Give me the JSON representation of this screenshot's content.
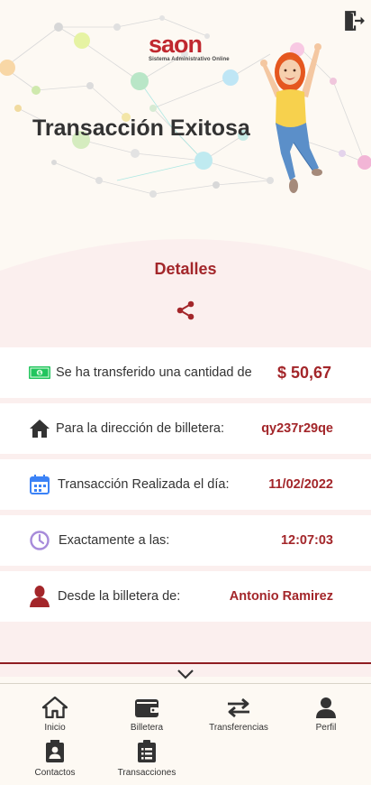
{
  "header": {
    "brand_name": "saon",
    "brand_tagline": "Sistema Administrativo Online",
    "title": "Transacción Exitosa",
    "logout_icon": "logout-icon"
  },
  "details": {
    "title": "Detalles",
    "share_icon": "share-icon",
    "rows": [
      {
        "icon": "money-icon",
        "label": "Se ha transferido una cantidad de",
        "value": "$ 50,67"
      },
      {
        "icon": "home-icon",
        "label": "Para la dirección de billetera:",
        "value": "qy237r29qe"
      },
      {
        "icon": "calendar-icon",
        "label": "Transacción Realizada el día:",
        "value": "11/02/2022"
      },
      {
        "icon": "clock-icon",
        "label": "Exactamente a las:",
        "value": "12:07:03"
      },
      {
        "icon": "user-icon",
        "label": "Desde la billetera de:",
        "value": "Antonio Ramirez"
      }
    ]
  },
  "nav": {
    "items": [
      {
        "icon": "home-icon",
        "label": "Inicio"
      },
      {
        "icon": "wallet-icon",
        "label": "Billetera"
      },
      {
        "icon": "transfer-icon",
        "label": "Transferencias"
      },
      {
        "icon": "profile-icon",
        "label": "Perfil"
      },
      {
        "icon": "contacts-icon",
        "label": "Contactos"
      },
      {
        "icon": "transactions-icon",
        "label": "Transacciones"
      }
    ]
  },
  "colors": {
    "accent": "#a3262a",
    "brand": "#c0282f",
    "background": "#fdf9f3",
    "money_green": "#22c55e",
    "calendar_blue": "#3b82f6",
    "clock_purple": "#a78bda"
  }
}
